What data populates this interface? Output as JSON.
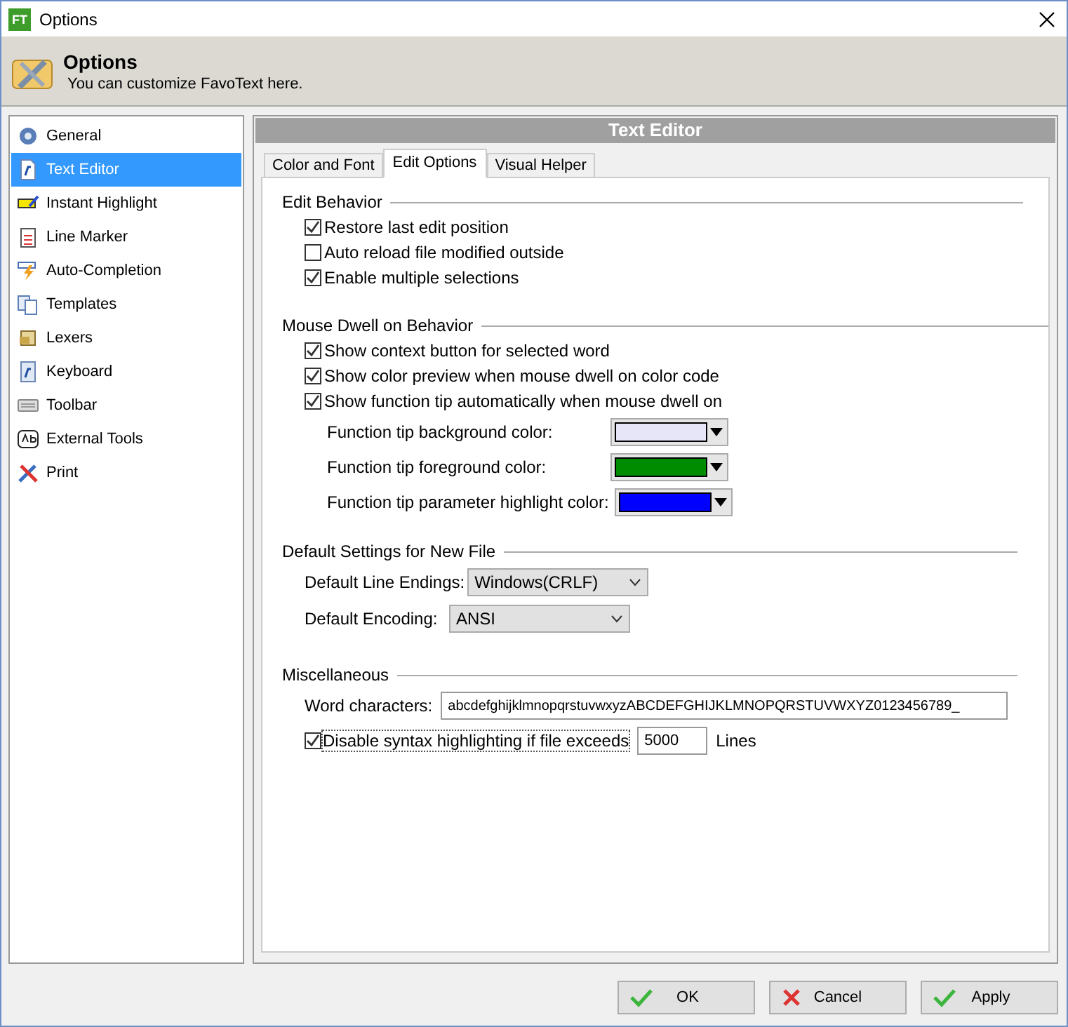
{
  "window": {
    "app_badge": "FT",
    "title": "Options"
  },
  "header": {
    "title": "Options",
    "subtitle": "You can customize FavoText here."
  },
  "sidebar": {
    "items": [
      {
        "label": "General",
        "selected": false
      },
      {
        "label": "Text Editor",
        "selected": true
      },
      {
        "label": "Instant Highlight",
        "selected": false
      },
      {
        "label": "Line Marker",
        "selected": false
      },
      {
        "label": "Auto-Completion",
        "selected": false
      },
      {
        "label": "Templates",
        "selected": false
      },
      {
        "label": "Lexers",
        "selected": false
      },
      {
        "label": "Keyboard",
        "selected": false
      },
      {
        "label": "Toolbar",
        "selected": false
      },
      {
        "label": "External Tools",
        "selected": false
      },
      {
        "label": "Print",
        "selected": false
      }
    ]
  },
  "panel": {
    "title": "Text Editor"
  },
  "tabs": [
    {
      "label": "Color and Font",
      "selected": false
    },
    {
      "label": "Edit Options",
      "selected": true
    },
    {
      "label": "Visual Helper",
      "selected": false
    }
  ],
  "edit_behavior": {
    "title": "Edit Behavior",
    "options": [
      {
        "label": "Restore last edit position",
        "checked": true
      },
      {
        "label": "Auto reload file modified outside",
        "checked": false
      },
      {
        "label": "Enable multiple selections",
        "checked": true
      }
    ]
  },
  "mouse_dwell": {
    "title": "Mouse Dwell on Behavior",
    "options": [
      {
        "label": "Show context button for selected word",
        "checked": true
      },
      {
        "label": "Show color preview when mouse dwell on color code",
        "checked": true
      },
      {
        "label": "Show function tip automatically when mouse dwell on",
        "checked": true
      }
    ],
    "colors": [
      {
        "label": "Function tip background color:",
        "color": "#e6e6f8"
      },
      {
        "label": "Function tip foreground color:",
        "color": "#008c00"
      },
      {
        "label": "Function tip parameter highlight color:",
        "color": "#0000ff"
      }
    ]
  },
  "defaults": {
    "title": "Default Settings for New File",
    "fields": [
      {
        "label": "Default Line Endings:",
        "value": "Windows(CRLF)"
      },
      {
        "label": "Default Encoding:",
        "value": "ANSI"
      }
    ]
  },
  "misc": {
    "title": "Miscellaneous",
    "word_label": "Word characters:",
    "word_value": "abcdefghijklmnopqrstuvwxyzABCDEFGHIJKLMNOPQRSTUVWXYZ0123456789_",
    "limit": {
      "label": "Disable syntax highlighting if file exceeds",
      "checked": true,
      "value": "5000",
      "unit": "Lines"
    }
  },
  "buttons": [
    {
      "label": "OK",
      "kind": "ok"
    },
    {
      "label": "Cancel",
      "kind": "cancel"
    },
    {
      "label": "Apply",
      "kind": "ok"
    }
  ]
}
